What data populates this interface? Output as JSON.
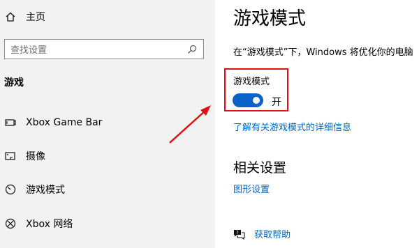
{
  "sidebar": {
    "home_label": "主页",
    "search_placeholder": "查找设置",
    "section_title": "游戏",
    "items": [
      {
        "label": "Xbox Game Bar",
        "icon": "gamebar-icon"
      },
      {
        "label": "摄像",
        "icon": "camera-icon"
      },
      {
        "label": "游戏模式",
        "icon": "gauge-icon"
      },
      {
        "label": "Xbox 网络",
        "icon": "xbox-icon"
      }
    ]
  },
  "main": {
    "title": "游戏模式",
    "description": "在“游戏模式”下，Windows 将优化你的电脑",
    "toggle_label": "游戏模式",
    "toggle_state": "开",
    "learn_more_link": "了解有关游戏模式的详细信息",
    "related_title": "相关设置",
    "graphics_link": "图形设置",
    "help_link": "获取帮助"
  },
  "colors": {
    "accent": "#0a63c9",
    "link": "#0067c0",
    "highlight": "#e01010",
    "sidebar_bg": "#f2f2f2"
  }
}
